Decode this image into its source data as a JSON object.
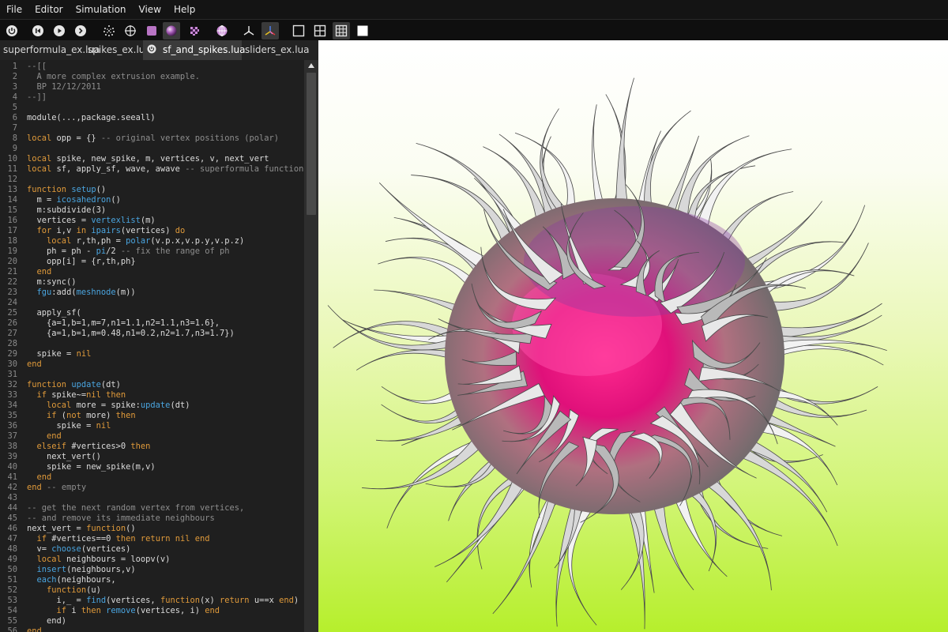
{
  "menu": [
    "File",
    "Editor",
    "Simulation",
    "View",
    "Help"
  ],
  "toolbar": {
    "icons": [
      "power-icon",
      "skip-back-icon",
      "play-icon",
      "step-forward-icon",
      "dots-sphere-icon",
      "crosshair-icon",
      "solid-cube-icon",
      "shaded-sphere-icon",
      "checker-icon",
      "wire-sphere-icon",
      "axes-icon",
      "colored-axes-icon",
      "layout-single-icon",
      "layout-quad-icon",
      "layout-grid-icon",
      "white-square-icon"
    ],
    "active": [
      "shaded-sphere-icon",
      "colored-axes-icon",
      "layout-grid-icon"
    ]
  },
  "tabs": [
    {
      "label": "superformula_ex.lua",
      "active": false
    },
    {
      "label": "spikes_ex.lua",
      "active": false
    },
    {
      "label": "sf_and_spikes.lua",
      "active": true
    },
    {
      "label": "sliders_ex.lua",
      "active": false
    }
  ],
  "editor": {
    "lines": [
      [
        [
          "--[[",
          "cm"
        ]
      ],
      [
        [
          "  A more complex extrusion example.",
          "cm"
        ]
      ],
      [
        [
          "  BP 12/12/2011",
          "cm"
        ]
      ],
      [
        [
          "--]]",
          "cm"
        ]
      ],
      [],
      [
        [
          "module(...,package.seeall)",
          "tx"
        ]
      ],
      [],
      [
        [
          "local",
          "kw"
        ],
        [
          " opp = {} ",
          "tx"
        ],
        [
          "-- original vertex positions (polar)",
          "cm"
        ]
      ],
      [],
      [
        [
          "local",
          "kw"
        ],
        [
          " spike, new_spike, m, vertices, v, next_vert",
          "tx"
        ]
      ],
      [
        [
          "local",
          "kw"
        ],
        [
          " sf, apply_sf, wave, awave ",
          "tx"
        ],
        [
          "-- superformula function",
          "cm"
        ]
      ],
      [],
      [
        [
          "function",
          "kw"
        ],
        [
          " ",
          "tx"
        ],
        [
          "setup",
          "fn"
        ],
        [
          "()",
          "tx"
        ]
      ],
      [
        [
          "  m = ",
          "tx"
        ],
        [
          "icosahedron",
          "fn"
        ],
        [
          "()",
          "tx"
        ]
      ],
      [
        [
          "  m:subdivide(3)",
          "tx"
        ]
      ],
      [
        [
          "  vertices = ",
          "tx"
        ],
        [
          "vertexlist",
          "fn"
        ],
        [
          "(m)",
          "tx"
        ]
      ],
      [
        [
          "  ",
          "tx"
        ],
        [
          "for",
          "kw"
        ],
        [
          " i,v ",
          "tx"
        ],
        [
          "in",
          "kw"
        ],
        [
          " ",
          "tx"
        ],
        [
          "ipairs",
          "fn"
        ],
        [
          "(vertices) ",
          "tx"
        ],
        [
          "do",
          "kw"
        ]
      ],
      [
        [
          "    ",
          "tx"
        ],
        [
          "local",
          "kw"
        ],
        [
          " r,th,ph = ",
          "tx"
        ],
        [
          "polar",
          "fn"
        ],
        [
          "(v.p.x,v.p.y,v.p.z)",
          "tx"
        ]
      ],
      [
        [
          "    ph = ph - ",
          "tx"
        ],
        [
          "pi",
          "fn"
        ],
        [
          "/2 ",
          "tx"
        ],
        [
          "-- fix the range of ph",
          "cm"
        ]
      ],
      [
        [
          "    opp[i] = {r,th,ph}",
          "tx"
        ]
      ],
      [
        [
          "  ",
          "tx"
        ],
        [
          "end",
          "kw"
        ]
      ],
      [
        [
          "  m:sync()",
          "tx"
        ]
      ],
      [
        [
          "  ",
          "tx"
        ],
        [
          "fgu",
          "fn"
        ],
        [
          ":add(",
          "tx"
        ],
        [
          "meshnode",
          "fn"
        ],
        [
          "(m))",
          "tx"
        ]
      ],
      [],
      [
        [
          "  apply_sf(",
          "tx"
        ]
      ],
      [
        [
          "    {a=1,b=1,m=7,n1=1.1,n2=1.1,n3=1.6},",
          "tx"
        ]
      ],
      [
        [
          "    {a=1,b=1,m=0.48,n1=0.2,n2=1.7,n3=1.7})",
          "tx"
        ]
      ],
      [],
      [
        [
          "  spike = ",
          "tx"
        ],
        [
          "nil",
          "kw"
        ]
      ],
      [
        [
          "end",
          "kw"
        ]
      ],
      [],
      [
        [
          "function",
          "kw"
        ],
        [
          " ",
          "tx"
        ],
        [
          "update",
          "fn"
        ],
        [
          "(dt)",
          "tx"
        ]
      ],
      [
        [
          "  ",
          "tx"
        ],
        [
          "if",
          "kw"
        ],
        [
          " spike~=",
          "tx"
        ],
        [
          "nil",
          "kw"
        ],
        [
          " ",
          "tx"
        ],
        [
          "then",
          "kw"
        ]
      ],
      [
        [
          "    ",
          "tx"
        ],
        [
          "local",
          "kw"
        ],
        [
          " more = spike:",
          "tx"
        ],
        [
          "update",
          "fn"
        ],
        [
          "(dt)",
          "tx"
        ]
      ],
      [
        [
          "    ",
          "tx"
        ],
        [
          "if",
          "kw"
        ],
        [
          " (",
          "tx"
        ],
        [
          "not",
          "kw"
        ],
        [
          " more) ",
          "tx"
        ],
        [
          "then",
          "kw"
        ]
      ],
      [
        [
          "      spike = ",
          "tx"
        ],
        [
          "nil",
          "kw"
        ]
      ],
      [
        [
          "    ",
          "tx"
        ],
        [
          "end",
          "kw"
        ]
      ],
      [
        [
          "  ",
          "tx"
        ],
        [
          "elseif",
          "kw"
        ],
        [
          " #vertices>0 ",
          "tx"
        ],
        [
          "then",
          "kw"
        ]
      ],
      [
        [
          "    next_vert()",
          "tx"
        ]
      ],
      [
        [
          "    spike = new_spike(m,v)",
          "tx"
        ]
      ],
      [
        [
          "  ",
          "tx"
        ],
        [
          "end",
          "kw"
        ]
      ],
      [
        [
          "end",
          "kw"
        ],
        [
          " ",
          "tx"
        ],
        [
          "-- empty",
          "cm"
        ]
      ],
      [],
      [
        [
          "-- get the next random vertex from vertices,",
          "cm"
        ]
      ],
      [
        [
          "-- and remove its immediate neighbours",
          "cm"
        ]
      ],
      [
        [
          "next_vert = ",
          "tx"
        ],
        [
          "function",
          "kw"
        ],
        [
          "()",
          "tx"
        ]
      ],
      [
        [
          "  ",
          "tx"
        ],
        [
          "if",
          "kw"
        ],
        [
          " #vertices==0 ",
          "tx"
        ],
        [
          "then",
          "kw"
        ],
        [
          " ",
          "tx"
        ],
        [
          "return",
          "kw"
        ],
        [
          " ",
          "tx"
        ],
        [
          "nil",
          "kw"
        ],
        [
          " ",
          "tx"
        ],
        [
          "end",
          "kw"
        ]
      ],
      [
        [
          "  v= ",
          "tx"
        ],
        [
          "choose",
          "fn"
        ],
        [
          "(vertices)",
          "tx"
        ]
      ],
      [
        [
          "  ",
          "tx"
        ],
        [
          "local",
          "kw"
        ],
        [
          " neighbours = loopv(v)",
          "tx"
        ]
      ],
      [
        [
          "  ",
          "tx"
        ],
        [
          "insert",
          "fn"
        ],
        [
          "(neighbours,v)",
          "tx"
        ]
      ],
      [
        [
          "  ",
          "tx"
        ],
        [
          "each",
          "fn"
        ],
        [
          "(neighbours,",
          "tx"
        ]
      ],
      [
        [
          "    ",
          "tx"
        ],
        [
          "function",
          "kw"
        ],
        [
          "(u)",
          "tx"
        ]
      ],
      [
        [
          "      i,_ = ",
          "tx"
        ],
        [
          "find",
          "fn"
        ],
        [
          "(vertices, ",
          "tx"
        ],
        [
          "function",
          "kw"
        ],
        [
          "(x) ",
          "tx"
        ],
        [
          "return",
          "kw"
        ],
        [
          " u==x ",
          "tx"
        ],
        [
          "end",
          "kw"
        ],
        [
          ")",
          "tx"
        ]
      ],
      [
        [
          "      ",
          "tx"
        ],
        [
          "if",
          "kw"
        ],
        [
          " i ",
          "tx"
        ],
        [
          "then",
          "kw"
        ],
        [
          " ",
          "tx"
        ],
        [
          "remove",
          "fn"
        ],
        [
          "(vertices, i) ",
          "tx"
        ],
        [
          "end",
          "kw"
        ]
      ],
      [
        [
          "    end)",
          "tx"
        ]
      ],
      [
        [
          "end",
          "kw"
        ]
      ]
    ]
  },
  "colors": {
    "keyword": "#e09a3a",
    "function": "#4aa5e0",
    "comment": "#8e8e8e",
    "text": "#dcdcdc",
    "line_number": "#8a8a8a",
    "viewport_top": "#ffffff",
    "viewport_bottom": "#b6ef2c",
    "mesh_core": "#e0107a"
  }
}
